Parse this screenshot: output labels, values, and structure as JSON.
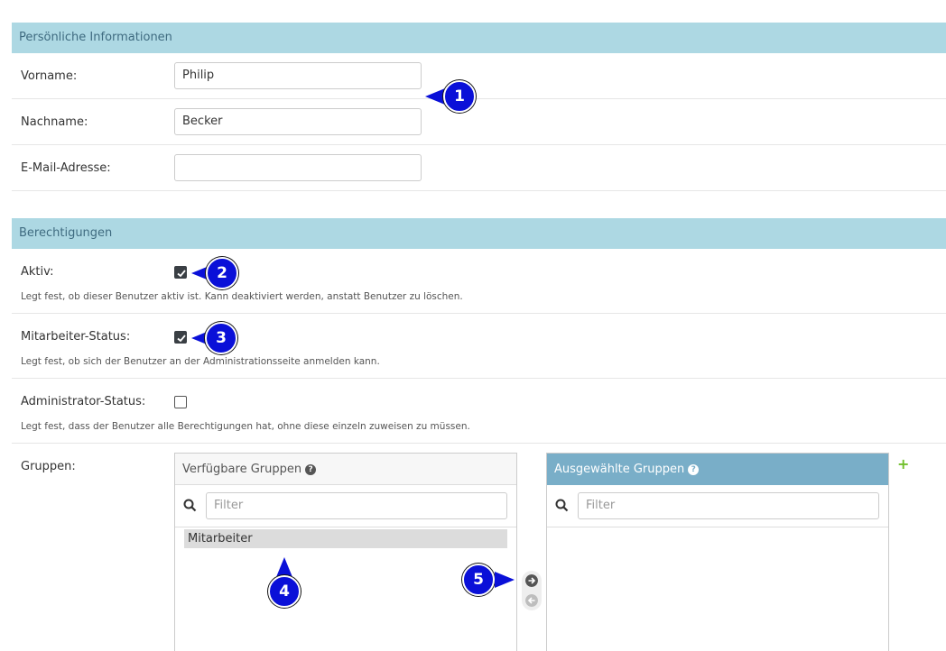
{
  "sections": {
    "personal": "Persönliche Informationen",
    "permissions": "Berechtigungen"
  },
  "fields": {
    "first_name": {
      "label": "Vorname:",
      "value": "Philip"
    },
    "last_name": {
      "label": "Nachname:",
      "value": "Becker"
    },
    "email": {
      "label": "E-Mail-Adresse:",
      "value": ""
    }
  },
  "permissions": {
    "active": {
      "label": "Aktiv:",
      "checked": true,
      "help": "Legt fest, ob dieser Benutzer aktiv ist. Kann deaktiviert werden, anstatt Benutzer zu löschen."
    },
    "staff": {
      "label": "Mitarbeiter-Status:",
      "checked": true,
      "help": "Legt fest, ob sich der Benutzer an der Administrationsseite anmelden kann."
    },
    "superuser": {
      "label": "Administrator-Status:",
      "checked": false,
      "help": "Legt fest, dass der Benutzer alle Berechtigungen hat, ohne diese einzeln zuweisen zu müssen."
    }
  },
  "groups": {
    "label": "Gruppen:",
    "available_title": "Verfügbare Gruppen",
    "chosen_title": "Ausgewählte Gruppen",
    "filter_placeholder": "Filter",
    "available_options": [
      "Mitarbeiter"
    ],
    "add_symbol": "+"
  },
  "callouts": [
    "1",
    "2",
    "3",
    "4",
    "5"
  ],
  "colors": {
    "section_header_bg": "#add8e3",
    "chosen_header_bg": "#79aec8",
    "callout_blue": "#0a10d8",
    "add_green": "#70bf2b"
  }
}
